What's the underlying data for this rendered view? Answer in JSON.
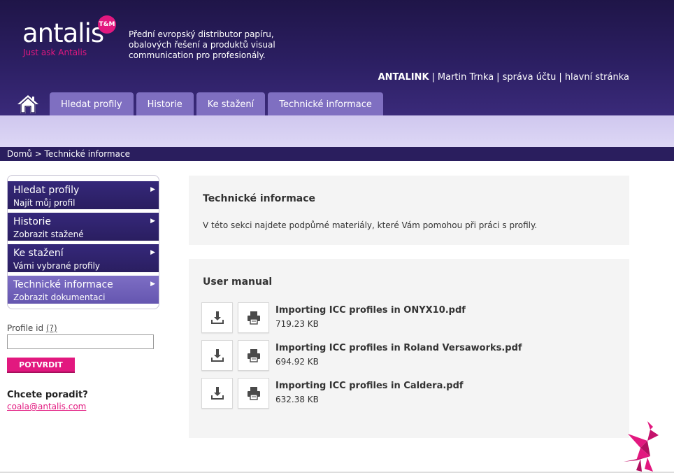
{
  "logo": {
    "wordmark": "antalis",
    "badge": "T&M",
    "tagline": "Just ask Antalis"
  },
  "intro": {
    "lines": [
      "Přední evropský distributor papíru,",
      "obalových řešení a produktů visual",
      "communication pro profesionály."
    ]
  },
  "top_links": {
    "brand": "ANTALINK",
    "user": "Martin Trnka",
    "account": "správa účtu",
    "home": "hlavní stránka",
    "separator": "|"
  },
  "nav": {
    "home_icon": "home-icon",
    "tabs": [
      {
        "label": "Hledat profily"
      },
      {
        "label": "Historie"
      },
      {
        "label": "Ke stažení"
      },
      {
        "label": "Technické informace"
      }
    ]
  },
  "breadcrumb": "Domů > Technické informace",
  "sidebar": {
    "items": [
      {
        "title": "Hledat profily",
        "subtitle": "Najít můj profil",
        "active": false
      },
      {
        "title": "Historie",
        "subtitle": "Zobrazit stažené",
        "active": false
      },
      {
        "title": "Ke stažení",
        "subtitle": "Vámi vybrané profily",
        "active": false
      },
      {
        "title": "Technické informace",
        "subtitle": "Zobrazit dokumentaci",
        "active": true
      }
    ],
    "arrow": "▶",
    "profile_label": "Profile id",
    "profile_help": "(?)",
    "profile_value": "",
    "confirm_label": "POTVRDIT",
    "advice_title": "Chcete poradit?",
    "advice_email": "coala@antalis.com"
  },
  "info_panel": {
    "title": "Technické informace",
    "description": "V této sekci najdete podpůrné materiály, které Vám pomohou při práci s profily."
  },
  "manual_panel": {
    "title": "User manual",
    "documents": [
      {
        "name": "Importing ICC profiles in ONYX10.pdf",
        "size": "719.23 KB"
      },
      {
        "name": "Importing ICC profiles in Roland Versaworks.pdf",
        "size": "694.92 KB"
      },
      {
        "name": "Importing ICC profiles in Caldera.pdf",
        "size": "632.38 KB"
      }
    ]
  },
  "colors": {
    "header_dark": "#1f1548",
    "tab": "#7f6fc1",
    "subbar": "#d6cff2",
    "accent_pink": "#e2187f",
    "menu_dark": "#2a1e60",
    "menu_active": "#6f60b8",
    "panel_bg": "#f4f4f4"
  }
}
